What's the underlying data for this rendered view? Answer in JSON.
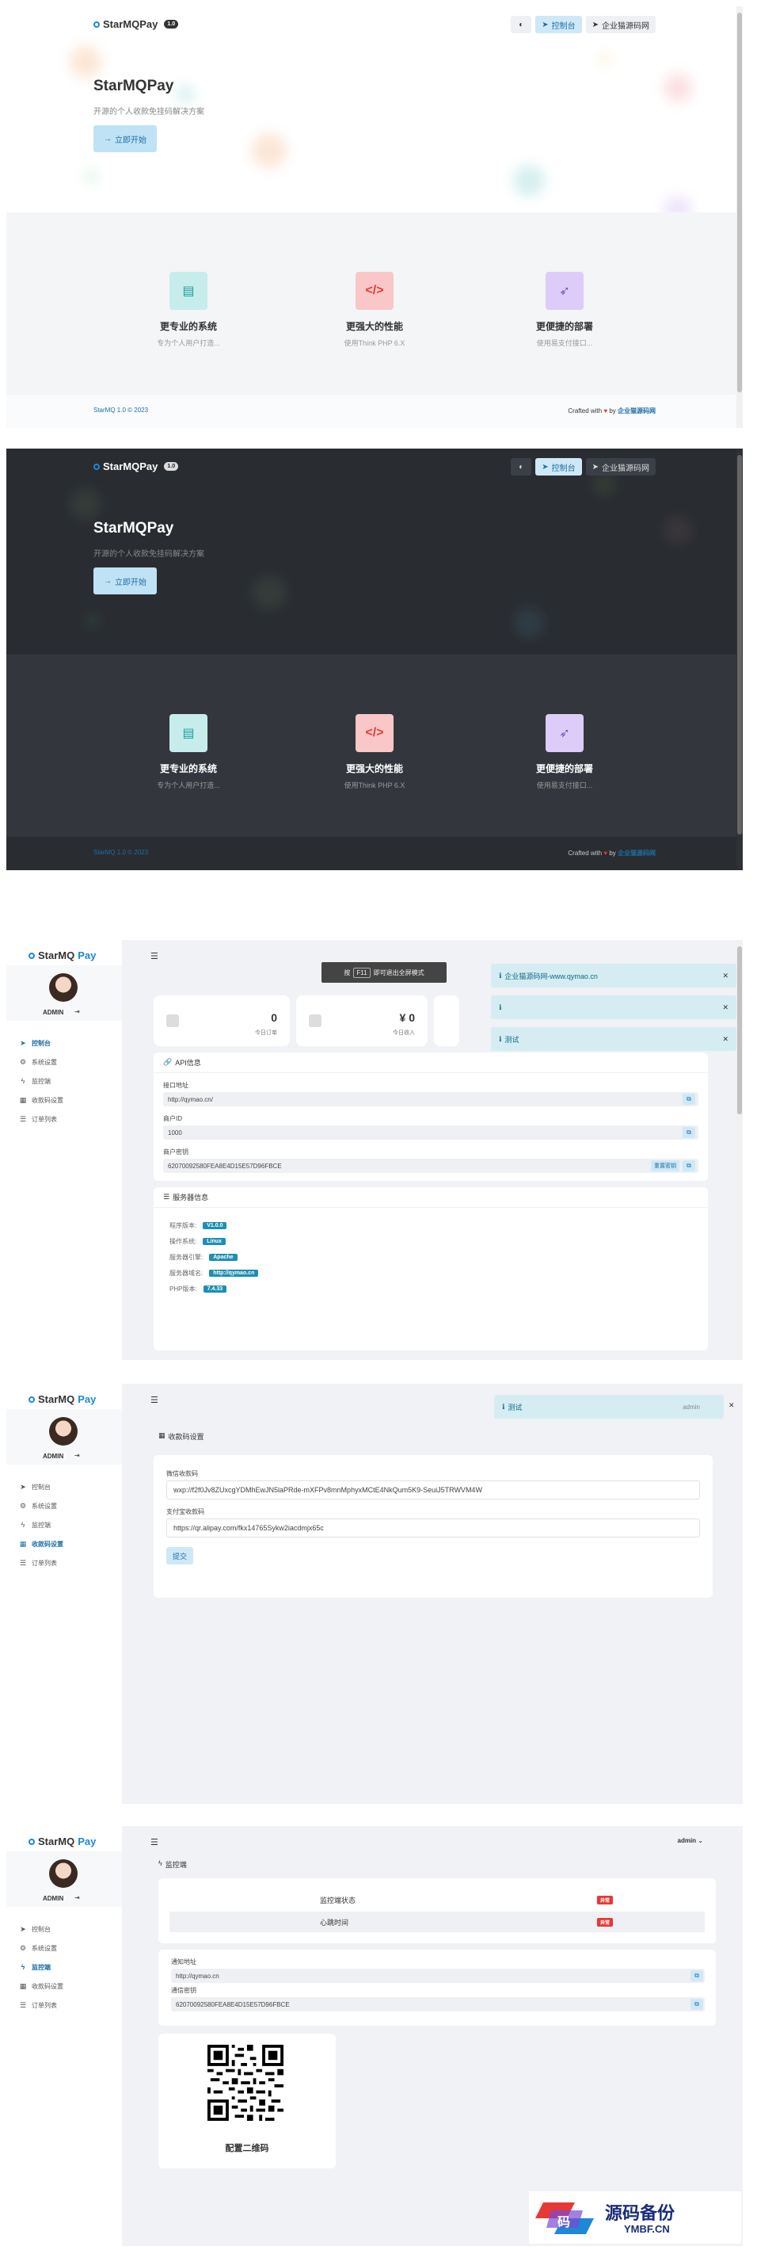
{
  "landing": {
    "brand": "StarMQPay",
    "version": "1.0",
    "nav": {
      "theme_icon": "moon-icon",
      "console": "控制台",
      "enterprise": "企业猫源码网"
    },
    "hero": {
      "title": "StarMQPay",
      "subtitle": "开源的个人收款免挂码解决方案",
      "cta": "立即开始"
    },
    "features": [
      {
        "title": "更专业的系统",
        "subtitle": "专为个人用户打造...",
        "icon": "card-icon",
        "color": "#1e9c9c"
      },
      {
        "title": "更强大的性能",
        "subtitle": "使用Think PHP 6.X",
        "icon": "code-icon",
        "color": "#e53935"
      },
      {
        "title": "更便捷的部署",
        "subtitle": "使用易支付接口...",
        "icon": "rocket-icon",
        "color": "#7a4ad1"
      }
    ],
    "footer": {
      "left": "StarMQ 1.0 © 2023",
      "crafted": "Crafted with",
      "by": "by",
      "author": "企业猫源码网"
    }
  },
  "dashboard": {
    "brand_a": "StarMQ",
    "brand_b": "Pay",
    "username": "ADMIN",
    "nav": [
      "控制台",
      "系统设置",
      "监控端",
      "收款码设置",
      "订单列表"
    ],
    "fullscreen_prefix": "按",
    "fullscreen_key": "F11",
    "fullscreen_suffix": "即可退出全屏模式",
    "stats": [
      {
        "value": "0",
        "label": "今日订单"
      },
      {
        "value": "¥ 0",
        "label": "今日收入"
      }
    ],
    "toasts": [
      "企业猫源码网-www.qymao.cn",
      "",
      "测试"
    ],
    "api": {
      "header": "API信息",
      "url_label": "接口地址",
      "url_value": "http://qymao.cn/",
      "id_label": "商户ID",
      "id_value": "1000",
      "key_label": "商户密钥",
      "key_value": "62070092580FEA8E4D15E57D96FBCE",
      "reset_label": "重置密钥"
    },
    "server": {
      "header": "服务器信息",
      "rows": [
        {
          "label": "程序版本:",
          "value": "V1.0.0"
        },
        {
          "label": "操作系统:",
          "value": "Linux"
        },
        {
          "label": "服务器引擎:",
          "value": "Apache"
        },
        {
          "label": "服务器域名:",
          "value": "http://qymao.cn"
        },
        {
          "label": "PHP版本:",
          "value": "7.4.33"
        }
      ]
    }
  },
  "qrcode": {
    "toast": "测试",
    "user": "admin",
    "header": "收款码设置",
    "wechat_label": "微信收款码",
    "wechat_value": "wxp://f2f0Jv8ZUxcgYDMhEwJN5laPRde-mXFPv8mnMphyxMCtE4NkQum5K9-SeuiJ5TRWVM4W",
    "alipay_label": "支付宝收款码",
    "alipay_value": "https://qr.alipay.com/fkx14765Sykw2iacdmjx65c",
    "submit": "提交"
  },
  "monitor": {
    "user": "admin",
    "header": "监控端",
    "status_rows": [
      {
        "label": "监控端状态",
        "badge": "异常"
      },
      {
        "label": "心跳时间",
        "badge": "异常"
      }
    ],
    "notify_label": "通知地址",
    "notify_value": "http://qymao.cn",
    "key_label": "通信密钥",
    "key_value": "62070092580FEA8E4D15E57D96FBCE",
    "qr_title": "配置二维码"
  },
  "watermark": {
    "text": "源码备份",
    "url": "YMBF.CN"
  }
}
